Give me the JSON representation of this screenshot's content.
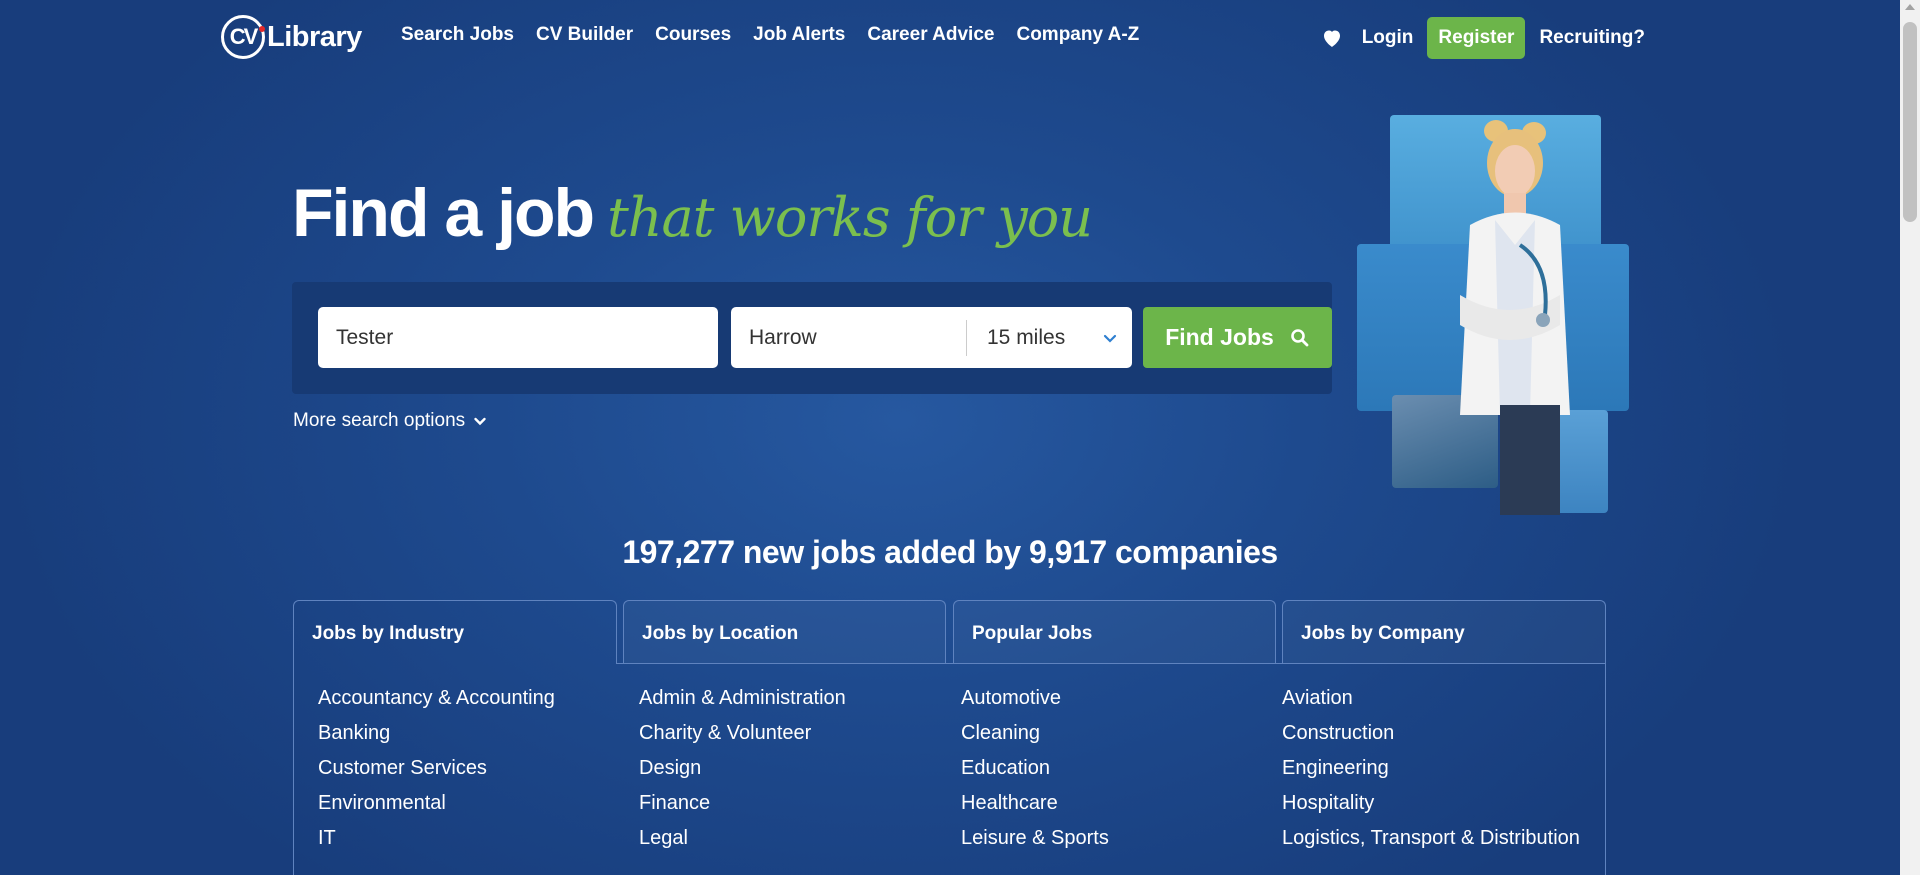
{
  "header": {
    "logo_mark": "CV",
    "logo_text": "Library",
    "nav": [
      "Search Jobs",
      "CV Builder",
      "Courses",
      "Job Alerts",
      "Career Advice",
      "Company A-Z"
    ],
    "login": "Login",
    "register": "Register",
    "recruiting": "Recruiting?"
  },
  "hero": {
    "title": "Find a job",
    "title_script": "that works for you"
  },
  "search": {
    "keyword_value": "Tester",
    "location_value": "Harrow",
    "distance_value": "15 miles",
    "find_label": "Find Jobs",
    "more_options": "More search options"
  },
  "stats": "197,277 new jobs added by 9,917 companies",
  "tabs": [
    "Jobs by Industry",
    "Jobs by Location",
    "Popular Jobs",
    "Jobs by Company"
  ],
  "jobs": {
    "col1": [
      "Accountancy & Accounting",
      "Banking",
      "Customer Services",
      "Environmental",
      "IT"
    ],
    "col2": [
      "Admin & Administration",
      "Charity & Volunteer",
      "Design",
      "Finance",
      "Legal"
    ],
    "col3": [
      "Automotive",
      "Cleaning",
      "Education",
      "Healthcare",
      "Leisure & Sports"
    ],
    "col4": [
      "Aviation",
      "Construction",
      "Engineering",
      "Hospitality",
      "Logistics, Transport & Distribution"
    ]
  },
  "colors": {
    "background": "#1e4a8e",
    "accent_green": "#6cb54a",
    "script_green": "#7bbf4e",
    "panel": "#173a74"
  },
  "icons": [
    "heart-icon",
    "search-icon",
    "chevron-down-icon"
  ]
}
